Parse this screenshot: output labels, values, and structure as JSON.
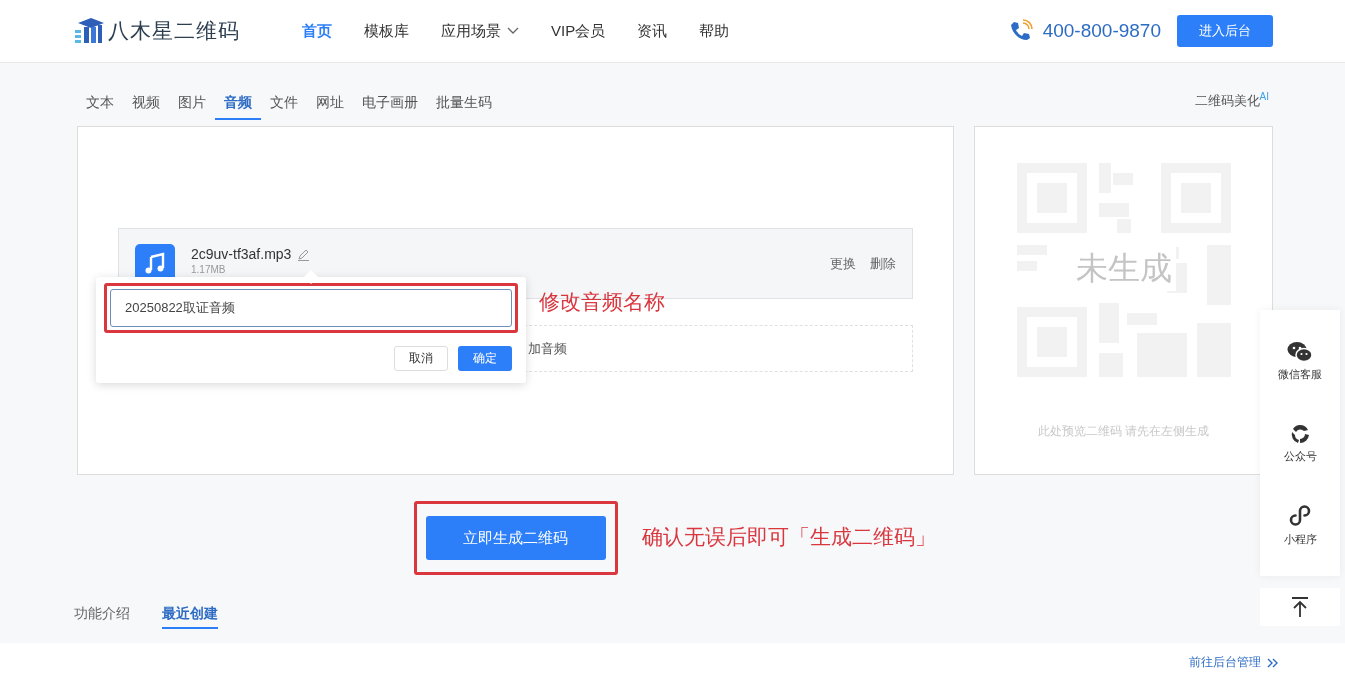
{
  "header": {
    "logo": "八木星二维码",
    "nav": [
      {
        "label": "首页",
        "selected": true,
        "dropdown": false
      },
      {
        "label": "模板库",
        "selected": false,
        "dropdown": false
      },
      {
        "label": "应用场景",
        "selected": false,
        "dropdown": true
      },
      {
        "label": "VIP会员",
        "selected": false,
        "dropdown": false
      },
      {
        "label": "资讯",
        "selected": false,
        "dropdown": false
      },
      {
        "label": "帮助",
        "selected": false,
        "dropdown": false
      }
    ],
    "phone": "400-800-9870",
    "console_button": "进入后台"
  },
  "type_tabs": [
    {
      "label": "文本",
      "selected": false
    },
    {
      "label": "视频",
      "selected": false
    },
    {
      "label": "图片",
      "selected": false
    },
    {
      "label": "音频",
      "selected": true
    },
    {
      "label": "文件",
      "selected": false
    },
    {
      "label": "网址",
      "selected": false
    },
    {
      "label": "电子画册",
      "selected": false
    },
    {
      "label": "批量生码",
      "selected": false
    }
  ],
  "beautify": {
    "label": "二维码美化",
    "badge": "AI"
  },
  "audio_file": {
    "name": "2c9uv-tf3af.mp3",
    "size": "1.17MB",
    "actions": [
      "更换",
      "删除"
    ]
  },
  "add_audio": "加音频",
  "rename_popup": {
    "value": "20250822取证音频",
    "buttons": [
      "取消",
      "确定"
    ],
    "annotation": "修改音频名称"
  },
  "preview": {
    "status": "未生成",
    "hint": "此处预览二维码 请先在左侧生成"
  },
  "generate": {
    "button": "立即生成二维码",
    "annotation": "确认无误后即可「生成二维码」"
  },
  "float_bar": [
    {
      "label": "微信客服",
      "kind": "wechat"
    },
    {
      "label": "公众号",
      "kind": "official"
    },
    {
      "label": "小程序",
      "kind": "miniapp"
    }
  ],
  "bottom_tabs": [
    {
      "label": "功能介绍",
      "selected": false
    },
    {
      "label": "最近创建",
      "selected": true
    }
  ],
  "footer_link": "前往后台管理"
}
